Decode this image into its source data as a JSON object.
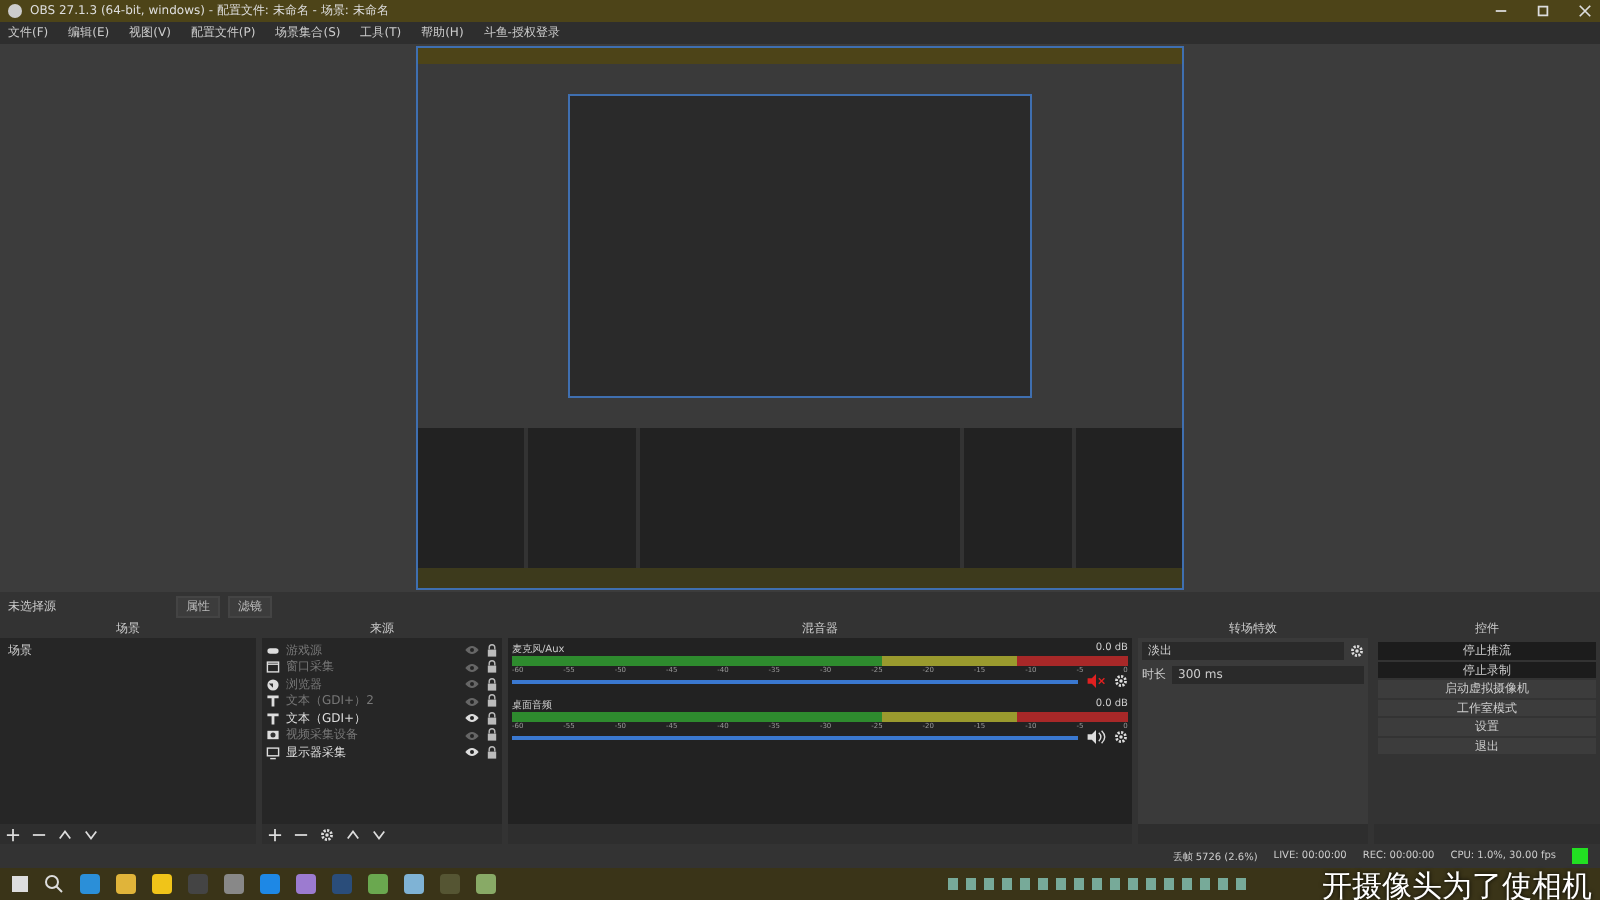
{
  "window": {
    "title": "OBS 27.1.3 (64-bit, windows) - 配置文件: 未命名 - 场景: 未命名"
  },
  "menu": [
    "文件(F)",
    "编辑(E)",
    "视图(V)",
    "配置文件(P)",
    "场景集合(S)",
    "工具(T)",
    "帮助(H)",
    "斗鱼-授权登录"
  ],
  "source_toolbar": {
    "label": "未选择源",
    "buttons": [
      "属性",
      "滤镜"
    ]
  },
  "scenes": {
    "title": "场景",
    "items": [
      {
        "name": "场景",
        "selected": false
      }
    ]
  },
  "sources": {
    "title": "来源",
    "items": [
      {
        "name": "游戏源",
        "kind": "game",
        "visible": false
      },
      {
        "name": "窗口采集",
        "kind": "window",
        "visible": false
      },
      {
        "name": "浏览器",
        "kind": "browser",
        "visible": false
      },
      {
        "name": "文本（GDI+）2",
        "kind": "text",
        "visible": false
      },
      {
        "name": "文本（GDI+）",
        "kind": "text",
        "visible": true
      },
      {
        "name": "视频采集设备",
        "kind": "camera",
        "visible": false
      },
      {
        "name": "显示器采集",
        "kind": "monitor",
        "visible": true
      }
    ]
  },
  "mixer": {
    "title": "混音器",
    "channels": [
      {
        "name": "麦克风/Aux",
        "reading": "0.0 dB",
        "muted": true,
        "level": 1,
        "ticks": [
          "-60",
          "-55",
          "-50",
          "-45",
          "-40",
          "-35",
          "-30",
          "-25",
          "-20",
          "-15",
          "-10",
          "-5",
          "0"
        ]
      },
      {
        "name": "桌面音频",
        "reading": "0.0 dB",
        "muted": false,
        "level": 1,
        "ticks": [
          "-60",
          "-55",
          "-50",
          "-45",
          "-40",
          "-35",
          "-30",
          "-25",
          "-20",
          "-15",
          "-10",
          "-5",
          "0"
        ]
      }
    ]
  },
  "transitions": {
    "title": "转场特效",
    "selected": "淡出",
    "duration_label": "时长",
    "duration": "300 ms"
  },
  "controls": {
    "title": "控件",
    "buttons": [
      {
        "label": "停止推流",
        "active": true
      },
      {
        "label": "停止录制",
        "active": true
      },
      {
        "label": "启动虚拟摄像机",
        "active": false
      },
      {
        "label": "工作室模式",
        "active": false
      },
      {
        "label": "设置",
        "active": false
      },
      {
        "label": "退出",
        "active": false
      }
    ]
  },
  "status_bar": [
    "丢帧 5726 (2.6%)",
    "LIVE: 00:00:00",
    "REC: 00:00:00",
    "CPU: 1.0%, 30.00 fps"
  ],
  "caption": "开摄像头为了使相机"
}
